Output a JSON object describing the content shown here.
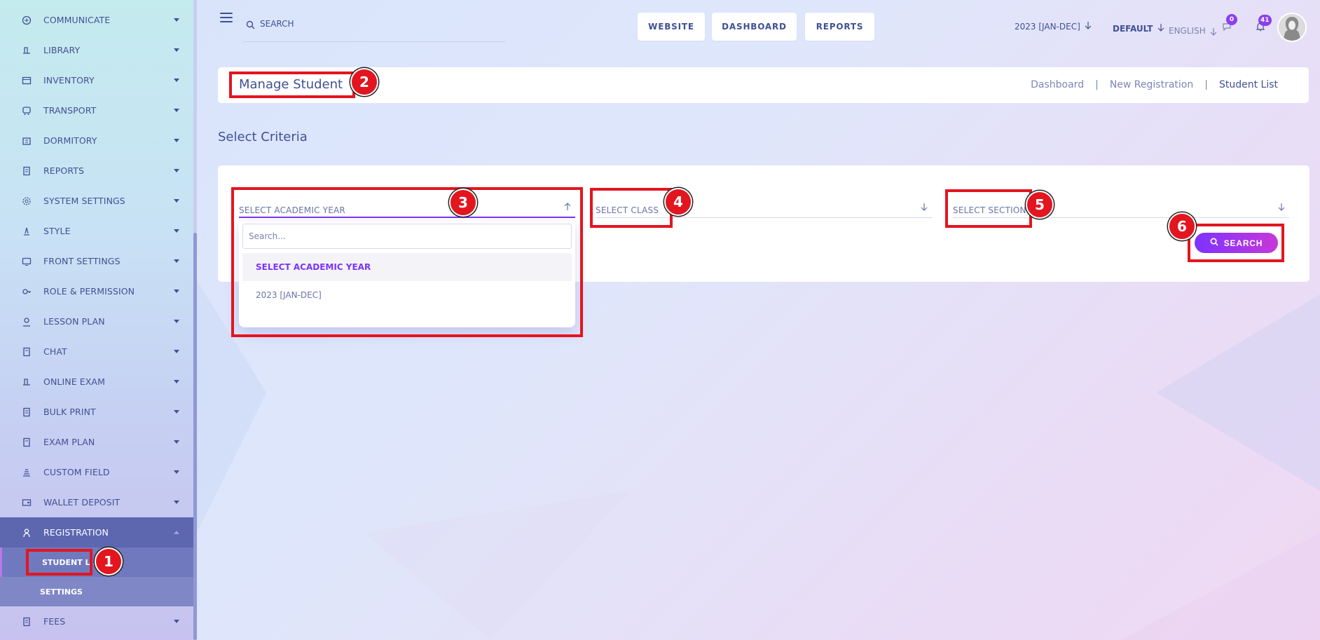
{
  "sidebar": {
    "items": [
      {
        "label": "COMMUNICATE",
        "icon": "megaphone-icon"
      },
      {
        "label": "LIBRARY",
        "icon": "book-icon"
      },
      {
        "label": "INVENTORY",
        "icon": "box-icon"
      },
      {
        "label": "TRANSPORT",
        "icon": "bus-icon"
      },
      {
        "label": "DORMITORY",
        "icon": "building-icon"
      },
      {
        "label": "REPORTS",
        "icon": "report-icon"
      },
      {
        "label": "SYSTEM SETTINGS",
        "icon": "gear-icon"
      },
      {
        "label": "STYLE",
        "icon": "style-icon"
      },
      {
        "label": "FRONT SETTINGS",
        "icon": "front-icon"
      },
      {
        "label": "ROLE & PERMISSION",
        "icon": "key-icon"
      },
      {
        "label": "LESSON PLAN",
        "icon": "lesson-icon"
      },
      {
        "label": "CHAT",
        "icon": "chat-icon"
      },
      {
        "label": "ONLINE EXAM",
        "icon": "exam-icon"
      },
      {
        "label": "BULK PRINT",
        "icon": "print-icon"
      },
      {
        "label": "EXAM PLAN",
        "icon": "plan-icon"
      },
      {
        "label": "CUSTOM FIELD",
        "icon": "field-icon"
      },
      {
        "label": "WALLET DEPOSIT",
        "icon": "wallet-icon"
      },
      {
        "label": "REGISTRATION",
        "icon": "user-icon",
        "active": true
      },
      {
        "label": "FEES",
        "icon": "fees-icon"
      }
    ],
    "registration_sub": [
      "STUDENT LIST",
      "SETTINGS"
    ]
  },
  "topbar": {
    "search_placeholder": "SEARCH",
    "buttons": [
      "WEBSITE",
      "DASHBOARD",
      "REPORTS"
    ],
    "academic_year": "2023 [JAN-DEC]",
    "theme": "DEFAULT",
    "language": "ENGLISH",
    "chat_badge": "0",
    "notification_badge": "41"
  },
  "header": {
    "title": "Manage Student",
    "breadcrumb": [
      "Dashboard",
      "New Registration",
      "Student List"
    ],
    "separator": "|"
  },
  "criteria": {
    "title": "Select Criteria",
    "academic_year_placeholder": "SELECT ACADEMIC YEAR",
    "class_placeholder": "SELECT CLASS",
    "section_placeholder": "SELECT SECTION",
    "dropdown_search_placeholder": "Search...",
    "dropdown_options": [
      "SELECT ACADEMIC YEAR",
      "2023 [JAN-DEC]"
    ],
    "search_button": "SEARCH"
  },
  "annotations": [
    "1",
    "2",
    "3",
    "4",
    "5",
    "6"
  ],
  "colors": {
    "accent": "#7c32ff",
    "text": "#415094",
    "highlight": "#e3151f",
    "sidebar_active": "#5c67b0"
  }
}
